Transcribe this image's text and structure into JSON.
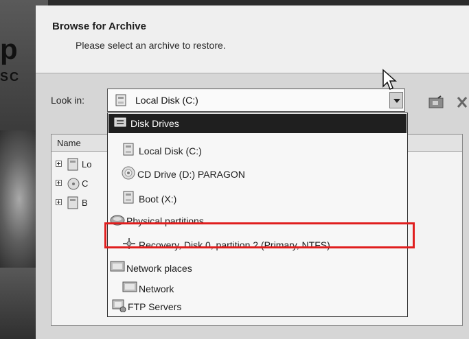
{
  "background": {
    "fragment_top": "p",
    "fragment_mid": "SC"
  },
  "dialog": {
    "title": "Browse for Archive",
    "subtitle": "Please select an archive to restore."
  },
  "look_in": {
    "label": "Look in:",
    "value": "Local Disk (C:)"
  },
  "tree": {
    "column_name": "Name",
    "rows": [
      {
        "text": "Lo",
        "icon": "disk-icon"
      },
      {
        "text": "C",
        "icon": "cd-drive-icon"
      },
      {
        "text": "B",
        "icon": "disk-icon"
      }
    ]
  },
  "dropdown": {
    "items": [
      {
        "label": "Disk Drives",
        "icon": "disk-drives-icon",
        "level": 0,
        "selected": true
      },
      {
        "label": "Local Disk (C:)",
        "icon": "disk-icon",
        "level": 1,
        "selected": false
      },
      {
        "label": "CD Drive (D:) PARAGON",
        "icon": "cd-drive-icon",
        "level": 1,
        "selected": false
      },
      {
        "label": "Boot (X:)",
        "icon": "disk-icon",
        "level": 1,
        "selected": false
      },
      {
        "label": "Physical partitions",
        "icon": "physical-partitions-icon",
        "level": 0,
        "selected": false
      },
      {
        "label": "Recovery, Disk 0, partition 2 (Primary, NTFS)",
        "icon": "partition-icon",
        "level": 1,
        "selected": false
      },
      {
        "label": "Network places",
        "icon": "network-places-icon",
        "level": 0,
        "selected": false
      },
      {
        "label": "Network",
        "icon": "network-icon",
        "level": 1,
        "selected": false
      },
      {
        "label": "FTP Servers",
        "icon": "ftp-servers-icon",
        "level": 0,
        "selected": false
      }
    ]
  },
  "colors": {
    "highlight": "#e01e1e",
    "selected_bg": "#1f1f1f"
  }
}
